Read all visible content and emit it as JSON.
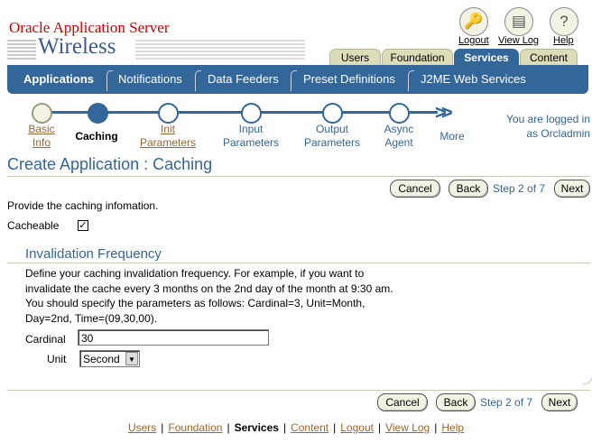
{
  "brand": {
    "line1": "Oracle Application Server",
    "line2": "Wireless"
  },
  "global": [
    {
      "label": "Logout",
      "icon": "logout-icon",
      "glyph": "🔑"
    },
    {
      "label": "View Log",
      "icon": "view-log-icon",
      "glyph": "▤"
    },
    {
      "label": "Help",
      "icon": "help-icon",
      "glyph": "?"
    }
  ],
  "tabs": [
    "Users",
    "Foundation",
    "Services",
    "Content"
  ],
  "active_tab": "Services",
  "subnav": [
    "Applications",
    "Notifications",
    "Data Feeders",
    "Preset Definitions",
    "J2ME Web Services"
  ],
  "train": {
    "steps": [
      {
        "l1": "Basic",
        "l2": "Info"
      },
      {
        "l1": "Caching",
        "l2": ""
      },
      {
        "l1": "Init",
        "l2": "Parameters"
      },
      {
        "l1": "Input",
        "l2": "Parameters"
      },
      {
        "l1": "Output",
        "l2": "Parameters"
      },
      {
        "l1": "Async",
        "l2": "Agent"
      }
    ],
    "more": "More"
  },
  "logged_in": {
    "line1": "You are logged in",
    "line2": "as Orcladmin"
  },
  "page_title": "Create Application : Caching",
  "buttons": {
    "cancel": "Cancel",
    "back": "Back",
    "next": "Next",
    "step": "Step 2 of 7"
  },
  "intro": "Provide the caching infomation.",
  "cacheable": {
    "label": "Cacheable",
    "checked": "✓"
  },
  "section": {
    "title": "Invalidation Frequency",
    "desc": [
      "Define your caching invalidation frequency. For example, if you want to",
      "invalidate the cache every 3 months on the 2nd day of the month at 9:30 am.",
      "You should specify the parameters as follows: Cardinal=3, Unit=Month,",
      "Day=2nd, Time=(09,30,00)."
    ]
  },
  "form": {
    "cardinal_label": "Cardinal",
    "cardinal_value": "30",
    "unit_label": "Unit",
    "unit_value": "Second"
  },
  "footer": [
    "Users",
    "Foundation",
    "Services",
    "Content",
    "Logout",
    "View Log",
    "Help"
  ]
}
